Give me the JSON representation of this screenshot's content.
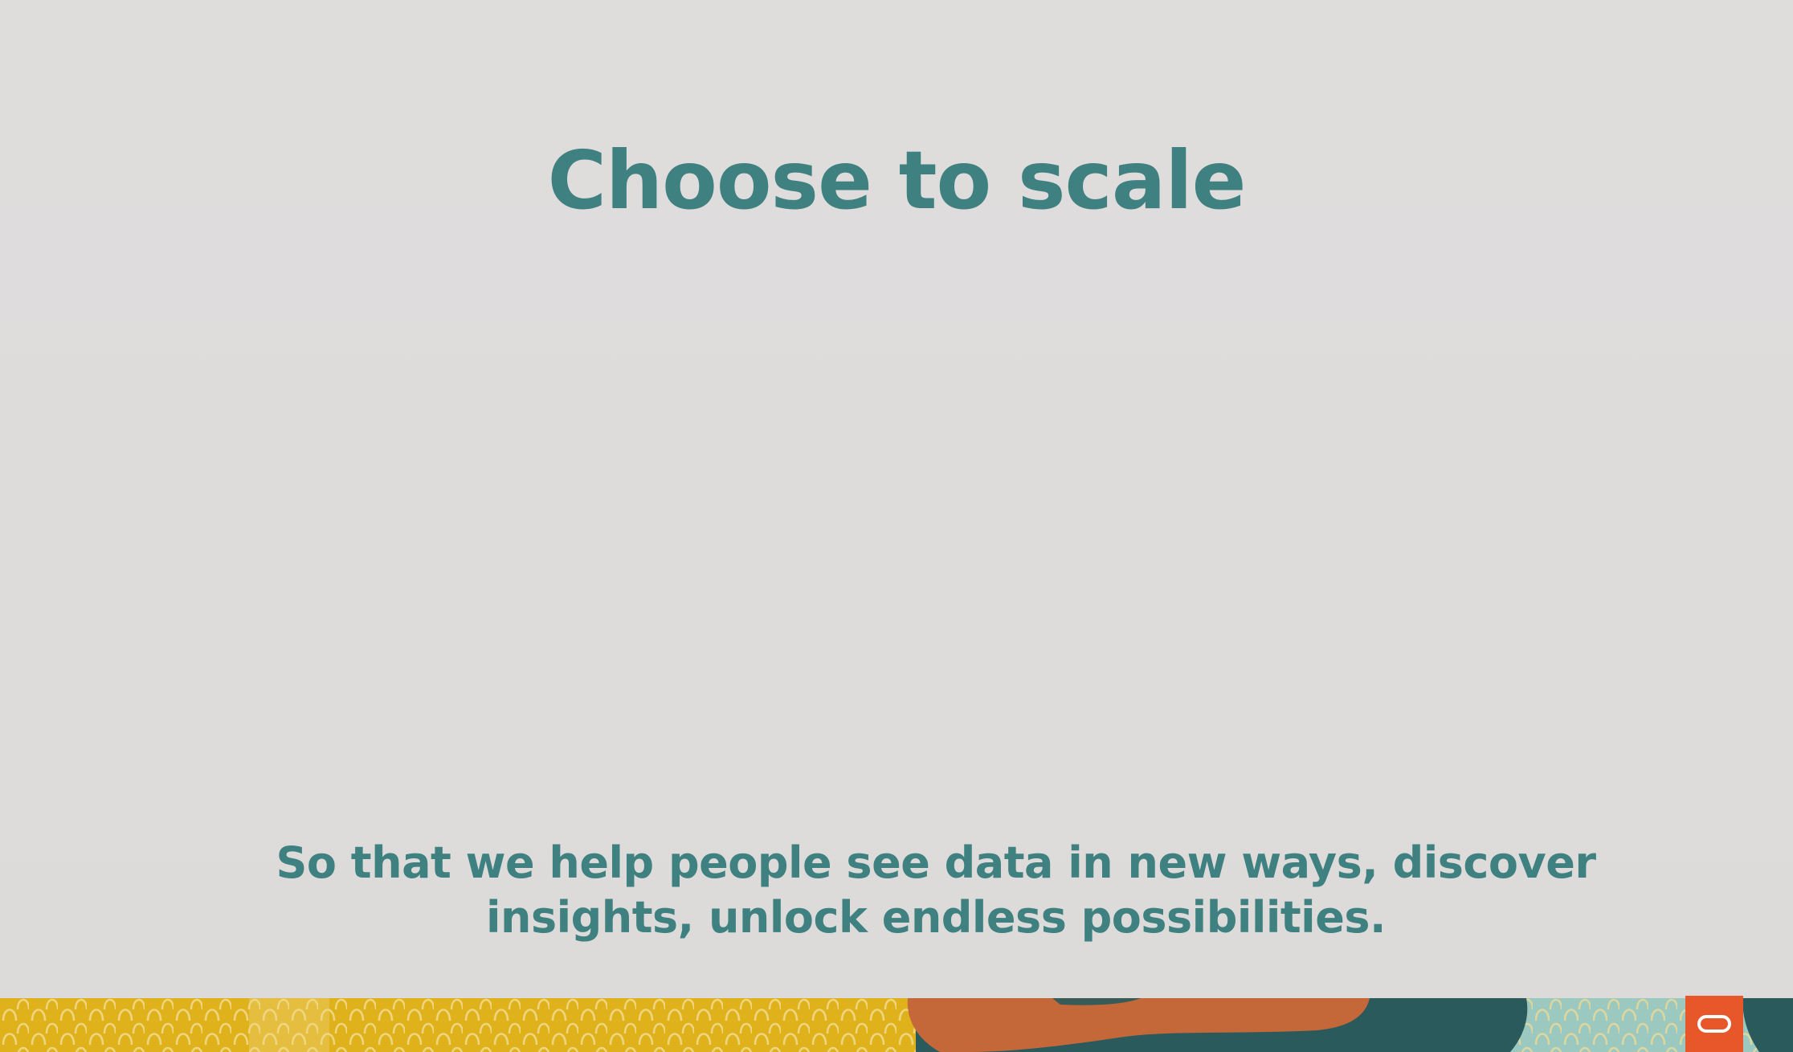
{
  "slide": {
    "title": "Choose to scale",
    "subtitle": "So that we help people see data in new ways, discover insights, unlock endless possibilities."
  },
  "colors": {
    "background": "#dedcdb",
    "text_teal": "#3f8080",
    "band_yellow": "#dfb21c",
    "band_orange": "#c4683a",
    "band_dark_teal": "#2a5a5c",
    "band_light_teal": "#9cc9bf",
    "logo_orange": "#e8572a"
  },
  "icons": {
    "brand_logo": "oracle-o-logo-icon"
  }
}
